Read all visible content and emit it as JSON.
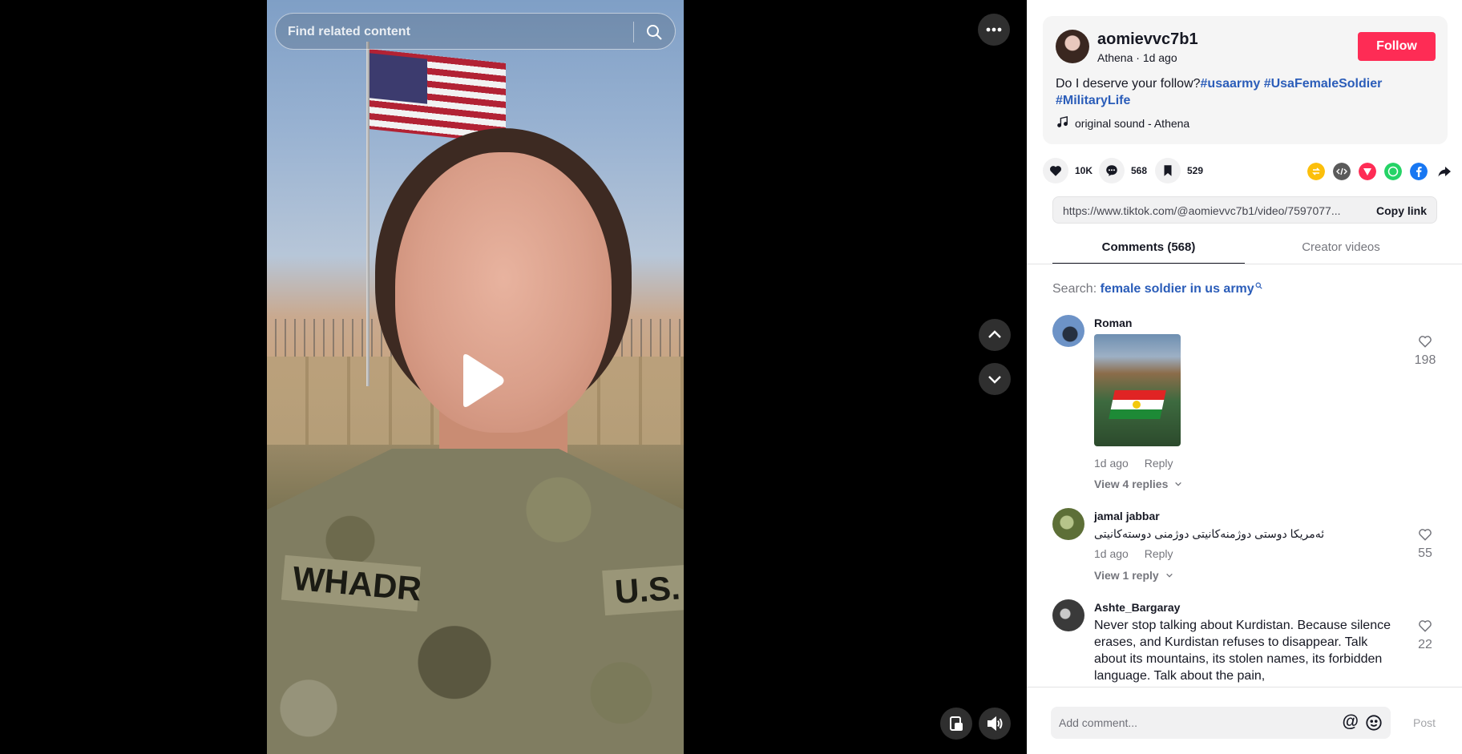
{
  "video": {
    "search_placeholder": "Find related content",
    "nametape": "WHADR",
    "ustape": "U.S."
  },
  "post": {
    "username": "aomievvc7b1",
    "meta": "Athena · 1d ago",
    "follow_label": "Follow",
    "description_text": "Do I deserve your follow?",
    "hashtags": [
      "#usaarmy",
      "#UsaFemaleSoldier",
      "#MilitaryLife"
    ],
    "sound": "original sound - Athena"
  },
  "stats": {
    "likes": "10K",
    "comments": "568",
    "saves": "529"
  },
  "share_icons": [
    {
      "name": "repost-icon",
      "color": "#fcbf0b"
    },
    {
      "name": "embed-icon",
      "color": "#5a5a5a"
    },
    {
      "name": "send-icon",
      "color": "#fe2c55"
    },
    {
      "name": "whatsapp-icon",
      "color": "#25d366"
    },
    {
      "name": "facebook-icon",
      "color": "#1877f2"
    },
    {
      "name": "share-arrow-icon",
      "color": "#161823"
    }
  ],
  "link": {
    "url": "https://www.tiktok.com/@aomievvc7b1/video/7597077...",
    "copy_label": "Copy link"
  },
  "tabs": {
    "comments": "Comments (568)",
    "creator": "Creator videos"
  },
  "search": {
    "prefix": "Search:",
    "query": "female soldier in us army"
  },
  "comments": [
    {
      "name": "Roman",
      "text": "",
      "time": "1d ago",
      "reply": "Reply",
      "replies": "View 4 replies",
      "likes": "198"
    },
    {
      "name": "jamal jabbar",
      "text": "ئەمریکا دوستی دوژمنەکانیتی دوژمنی دوستەکانیتی",
      "time": "1d ago",
      "reply": "Reply",
      "replies": "View 1 reply",
      "likes": "55"
    },
    {
      "name": "Ashte_Bargaray",
      "text": "Never stop talking about Kurdistan. Because silence erases, and Kurdistan refuses to disappear. Talk about its mountains, its stolen names, its forbidden language. Talk about the pain,",
      "likes": "22"
    }
  ],
  "composer": {
    "placeholder": "Add comment...",
    "at": "@",
    "post_label": "Post"
  },
  "colors": {
    "brand": "#fe2c55",
    "link": "#2b5db9",
    "text": "#161823"
  }
}
